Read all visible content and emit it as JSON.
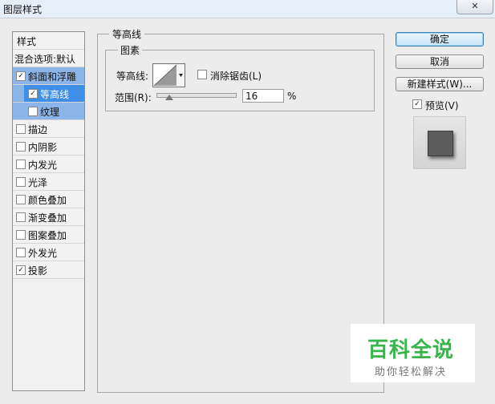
{
  "window": {
    "title": "图层样式",
    "close_glyph": "✕"
  },
  "sidebar": {
    "items": [
      {
        "label": "样式"
      },
      {
        "label": "混合选项:默认"
      },
      {
        "label": "斜面和浮雕",
        "checked": "✓"
      },
      {
        "label": "等高线",
        "checked": "✓"
      },
      {
        "label": "纹理",
        "checked": ""
      },
      {
        "label": "描边",
        "checked": ""
      },
      {
        "label": "内阴影",
        "checked": ""
      },
      {
        "label": "内发光",
        "checked": ""
      },
      {
        "label": "光泽",
        "checked": ""
      },
      {
        "label": "颜色叠加",
        "checked": ""
      },
      {
        "label": "渐变叠加",
        "checked": ""
      },
      {
        "label": "图案叠加",
        "checked": ""
      },
      {
        "label": "外发光",
        "checked": ""
      },
      {
        "label": "投影",
        "checked": "✓"
      }
    ]
  },
  "panel": {
    "group_title": "等高线",
    "subgroup_title": "图素",
    "contour_label": "等高线:",
    "antialias_label": "消除锯齿(L)",
    "antialias_checked": "",
    "range_label": "范围(R):",
    "range_value": "16",
    "range_unit": "%",
    "range_fraction": 0.16
  },
  "buttons": {
    "ok": "确定",
    "cancel": "取消",
    "new_style": "新建样式(W)...",
    "preview_label": "预览(V)",
    "preview_checked": "✓"
  },
  "watermark": {
    "title": "百科全说",
    "subtitle": "助你轻松解决"
  },
  "colors": {
    "selected_row": "#3f8ee8",
    "selected_parent": "#8bb5e8",
    "ok_border": "#3c7fb1",
    "watermark_green": "#35b54a"
  }
}
